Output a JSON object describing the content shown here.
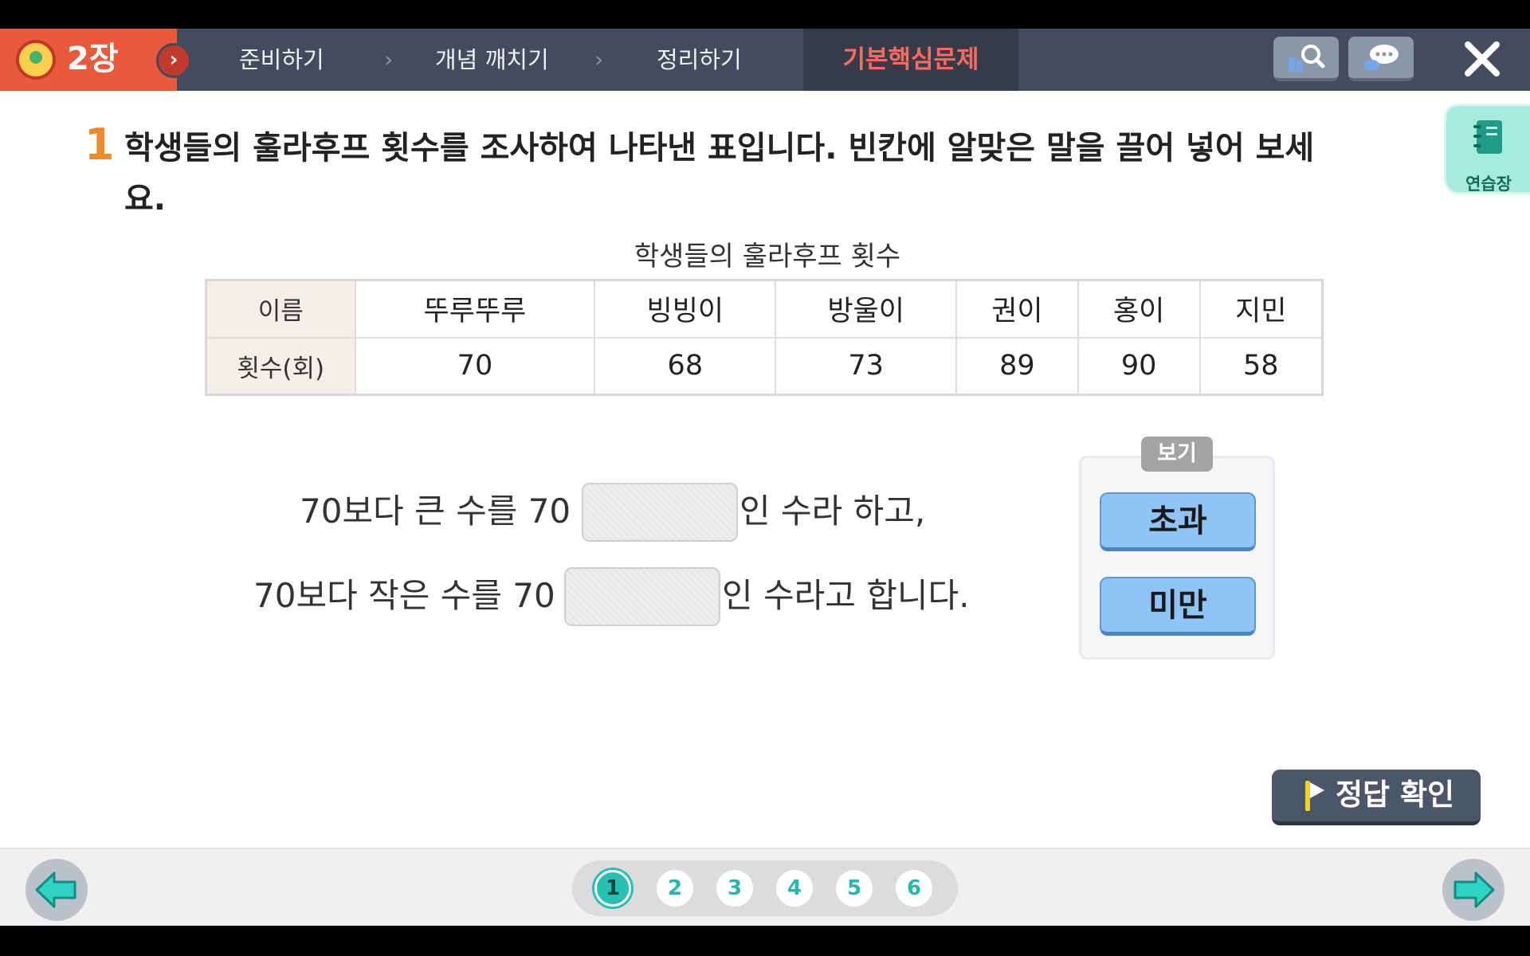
{
  "header": {
    "chapter": "2장",
    "breadcrumbs": [
      "준비하기",
      "개념 깨치기",
      "정리하기"
    ],
    "active_tab": "기본핵심문제"
  },
  "question": {
    "number": "1",
    "text": "학생들의 훌라후프 횟수를 조사하여 나타낸 표입니다. 빈칸에 알맞은 말을 끌어 넣어 보세요."
  },
  "notebook_label": "연습장",
  "table": {
    "title": "학생들의 훌라후프 횟수",
    "row_headers": [
      "이름",
      "횟수(회)"
    ],
    "names": [
      "뚜루뚜루",
      "빙빙이",
      "방울이",
      "권이",
      "홍이",
      "지민"
    ],
    "counts": [
      "70",
      "68",
      "73",
      "89",
      "90",
      "58"
    ]
  },
  "sentences": {
    "line1_before": "70보다 큰 수를 70",
    "line1_after": "인 수라 하고,",
    "line2_before": "70보다 작은 수를 70",
    "line2_after": "인 수라고 합니다."
  },
  "example": {
    "tag": "보기",
    "choices": [
      "초과",
      "미만"
    ]
  },
  "check_answer": "정답 확인",
  "pager": {
    "pages": [
      "1",
      "2",
      "3",
      "4",
      "5",
      "6"
    ],
    "current": "1"
  },
  "colors": {
    "header_bg": "#424c5c",
    "chapter_bg": "#e95a3c",
    "active_tab_text": "#ff6a5c",
    "question_number": "#f08a27",
    "choice_bg": "#8fc4f7",
    "pager_accent": "#27c0b1"
  }
}
